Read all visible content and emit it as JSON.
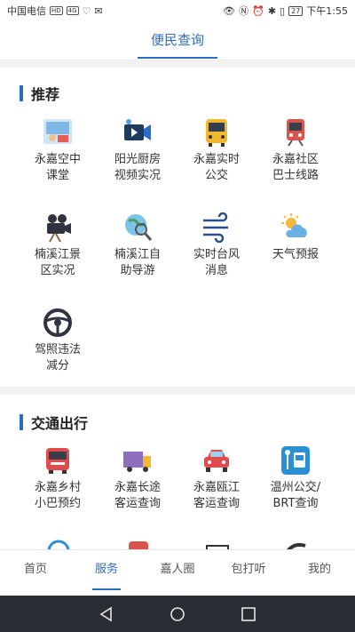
{
  "status_bar": {
    "carrier": "中国电信",
    "hd_badge": "HD",
    "signal_badge": "4G",
    "battery": "27",
    "time": "下午1:55"
  },
  "header": {
    "tab_label": "便民查询"
  },
  "sections": [
    {
      "title": "推荐",
      "items": [
        {
          "label": "永嘉空中\n课堂",
          "icon": "classroom-icon"
        },
        {
          "label": "阳光厨房\n视频实况",
          "icon": "video-camera-icon"
        },
        {
          "label": "永嘉实时\n公交",
          "icon": "bus-icon"
        },
        {
          "label": "永嘉社区\n巴士线路",
          "icon": "train-icon"
        },
        {
          "label": "楠溪江景\n区实况",
          "icon": "film-camera-icon"
        },
        {
          "label": "楠溪江自\n助导游",
          "icon": "globe-search-icon"
        },
        {
          "label": "实时台风\n消息",
          "icon": "wind-icon"
        },
        {
          "label": "天气预报",
          "icon": "weather-icon"
        },
        {
          "label": "驾照违法\n减分",
          "icon": "steering-wheel-icon"
        }
      ]
    },
    {
      "title": "交通出行",
      "items": [
        {
          "label": "永嘉乡村\n小巴预约",
          "icon": "minibus-icon"
        },
        {
          "label": "永嘉长途\n客运查询",
          "icon": "truck-icon"
        },
        {
          "label": "永嘉瓯江\n客运查询",
          "icon": "car-icon"
        },
        {
          "label": "温州公交/\nBRT查询",
          "icon": "bus-stop-icon"
        }
      ]
    }
  ],
  "bottom_nav": [
    "首页",
    "服务",
    "嘉人圈",
    "包打听",
    "我的"
  ],
  "colors": {
    "accent": "#2b6cc4"
  }
}
